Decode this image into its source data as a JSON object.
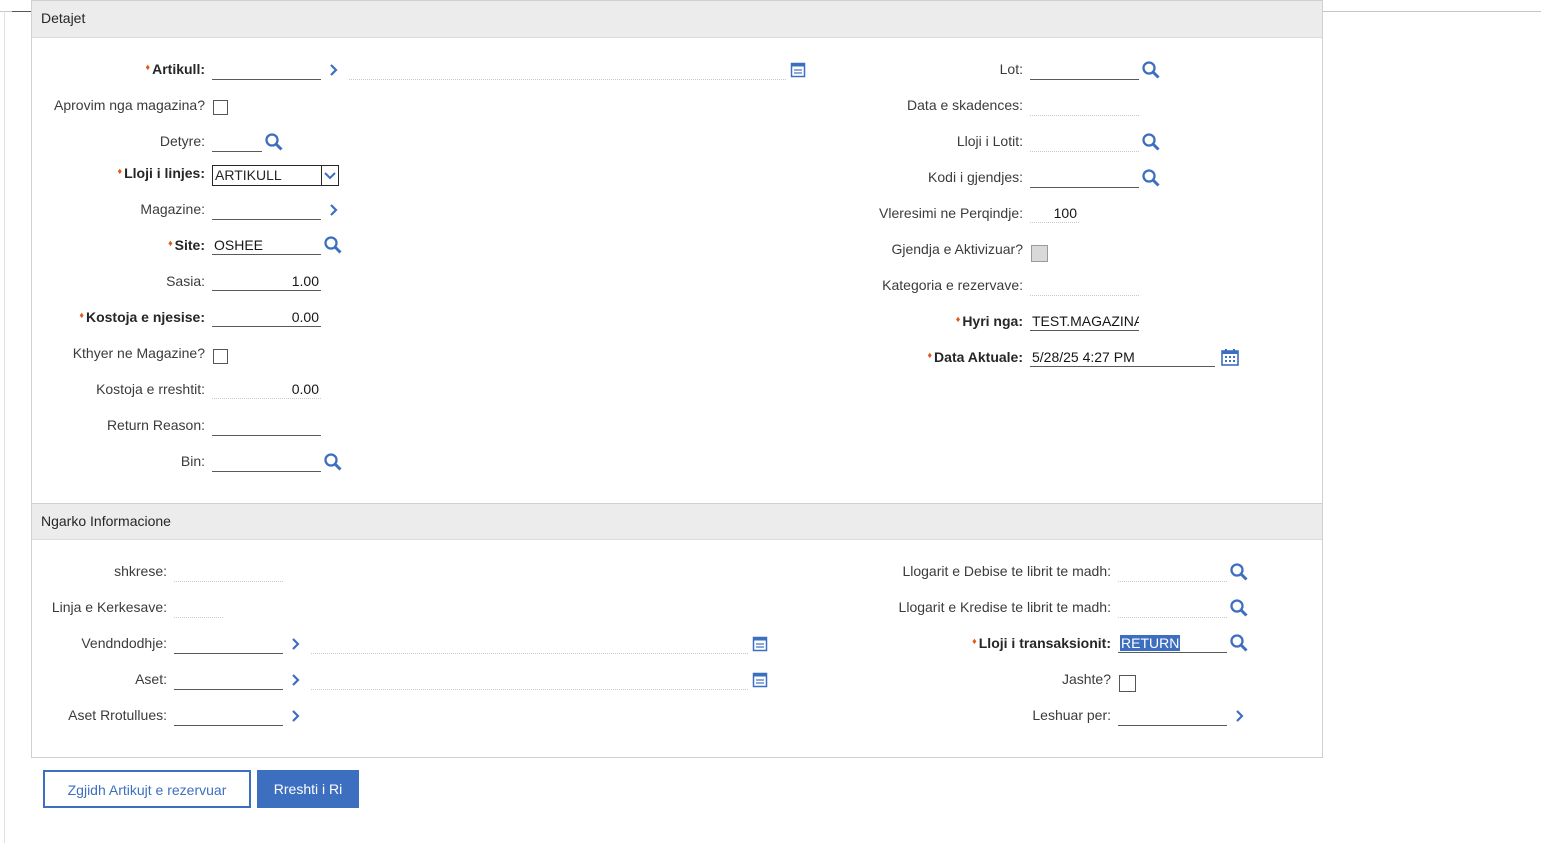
{
  "sections": {
    "details_title": "Detajet",
    "load_title": "Ngarko Informacione"
  },
  "details": {
    "artikull_label": "Artikull:",
    "artikull_value": "",
    "aprovim_label": "Aprovim nga magazina?",
    "aprovim_checked": false,
    "detyre_label": "Detyre:",
    "detyre_value": "",
    "lloji_linjes_label": "Lloji i linjes:",
    "lloji_linjes_value": "ARTIKULL",
    "magazine_label": "Magazine:",
    "magazine_value": "",
    "site_label": "Site:",
    "site_value": "OSHEE",
    "sasia_label": "Sasia:",
    "sasia_value": "1.00",
    "kostoja_njesise_label": "Kostoja e njesise:",
    "kostoja_njesise_value": "0.00",
    "kthyer_label": "Kthyer ne Magazine?",
    "kthyer_checked": false,
    "kostoja_rreshtit_label": "Kostoja e rreshtit:",
    "kostoja_rreshtit_value": "0.00",
    "return_reason_label": "Return Reason:",
    "return_reason_value": "",
    "bin_label": "Bin:",
    "bin_value": "",
    "lot_label": "Lot:",
    "lot_value": "",
    "data_skadences_label": "Data e skadences:",
    "data_skadences_value": "",
    "lloji_lotit_label": "Lloji i Lotit:",
    "lloji_lotit_value": "",
    "kodi_gjendjes_label": "Kodi i gjendjes:",
    "kodi_gjendjes_value": "",
    "vleresimi_label": "Vleresimi ne Perqindje:",
    "vleresimi_value": "100",
    "gjendja_aktivizuar_label": "Gjendja e Aktivizuar?",
    "gjendja_aktivizuar_checked": false,
    "kategoria_label": "Kategoria e rezervave:",
    "kategoria_value": "",
    "hyri_nga_label": "Hyri nga:",
    "hyri_nga_value": "TEST.MAGAZINA",
    "data_aktuale_label": "Data Aktuale:",
    "data_aktuale_value": "5/28/25 4:27 PM"
  },
  "load": {
    "shkrese_label": "shkrese:",
    "shkrese_value": "",
    "linja_kerkesave_label": "Linja e Kerkesave:",
    "linja_kerkesave_value": "",
    "vendndodhje_label": "Vendndodhje:",
    "vendndodhje_value": "",
    "aset_label": "Aset:",
    "aset_value": "",
    "aset_rrotullues_label": "Aset Rrotullues:",
    "aset_rrotullues_value": "",
    "debise_label": "Llogarit e Debise te librit te madh:",
    "debise_value": "",
    "kredise_label": "Llogarit e Kredise te librit te madh:",
    "kredise_value": "",
    "transaksionit_label": "Lloji i transaksionit:",
    "transaksionit_value": "RETURN",
    "jashte_label": "Jashte?",
    "jashte_checked": false,
    "leshuar_label": "Leshuar per:",
    "leshuar_value": ""
  },
  "buttons": {
    "select_reserved": "Zgjidh Artikujt e rezervuar",
    "new_row": "Rreshti i Ri"
  },
  "colors": {
    "accent": "#3d6fc0",
    "required_marker": "#e05a1e",
    "section_header_bg": "#ececec"
  },
  "icons": {
    "lookup": "magnifier-icon",
    "detail_menu": "chevron-right-icon",
    "long_description": "long-description-icon",
    "calendar": "calendar-icon"
  }
}
